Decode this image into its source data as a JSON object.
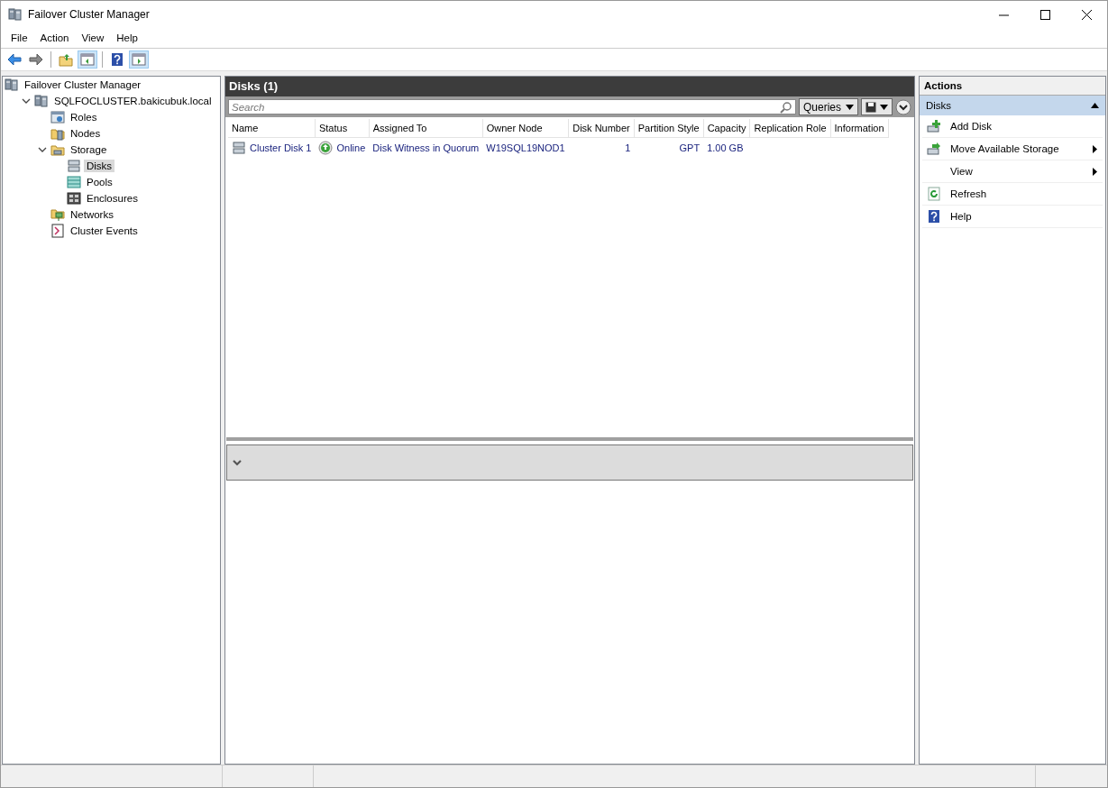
{
  "window": {
    "title": "Failover Cluster Manager"
  },
  "menu": [
    "File",
    "Action",
    "View",
    "Help"
  ],
  "toolbar": [
    {
      "kind": "back",
      "pressed": false
    },
    {
      "kind": "forward",
      "pressed": false
    },
    {
      "kind": "up",
      "pressed": false
    },
    {
      "kind": "tree-toggle",
      "pressed": true
    },
    {
      "kind": "help",
      "pressed": false
    },
    {
      "kind": "action-toggle",
      "pressed": true
    }
  ],
  "tree": {
    "label": "Failover Cluster Manager",
    "kind": "manager",
    "selected": false,
    "children": [
      {
        "label": "SQLFOCLUSTER.bakicubuk.local",
        "kind": "cluster",
        "selected": false,
        "expanded": true,
        "children": [
          {
            "label": "Roles",
            "kind": "roles",
            "selected": false
          },
          {
            "label": "Nodes",
            "kind": "nodes",
            "selected": false
          },
          {
            "label": "Storage",
            "kind": "folder",
            "selected": false,
            "expanded": true,
            "children": [
              {
                "label": "Disks",
                "kind": "disk",
                "selected": true
              },
              {
                "label": "Pools",
                "kind": "pool",
                "selected": false
              },
              {
                "label": "Enclosures",
                "kind": "enclosure",
                "selected": false
              }
            ]
          },
          {
            "label": "Networks",
            "kind": "network",
            "selected": false
          },
          {
            "label": "Cluster Events",
            "kind": "events",
            "selected": false
          }
        ]
      }
    ]
  },
  "center": {
    "title": "Disks (1)",
    "search": {
      "placeholder": "Search"
    },
    "queries_button": "Queries",
    "columns": [
      {
        "label": "Name"
      },
      {
        "label": "Status"
      },
      {
        "label": "Assigned To"
      },
      {
        "label": "Owner Node"
      },
      {
        "label": "Disk Number"
      },
      {
        "label": "Partition Style"
      },
      {
        "label": "Capacity"
      },
      {
        "label": "Replication Role"
      },
      {
        "label": "Information"
      }
    ],
    "rows": [
      {
        "selected": false,
        "cells": [
          "Cluster Disk 1",
          "Online",
          "Disk Witness in Quorum",
          "W19SQL19NOD1",
          "1",
          "GPT",
          "1.00 GB"
        ]
      }
    ],
    "details": {
      "expanded": false
    }
  },
  "actions": {
    "title": "Actions",
    "sections": [
      {
        "label": "Disks",
        "expanded": true,
        "items": [
          {
            "label": "Add Disk",
            "kind": "add-disk",
            "submenu": false
          },
          {
            "label": "Move Available Storage",
            "kind": "move-disk",
            "submenu": true
          },
          {
            "label": "View",
            "kind": "plain",
            "submenu": true
          },
          {
            "label": "Refresh",
            "kind": "refresh",
            "submenu": false
          },
          {
            "label": "Help",
            "kind": "help",
            "submenu": false
          }
        ]
      }
    ]
  }
}
